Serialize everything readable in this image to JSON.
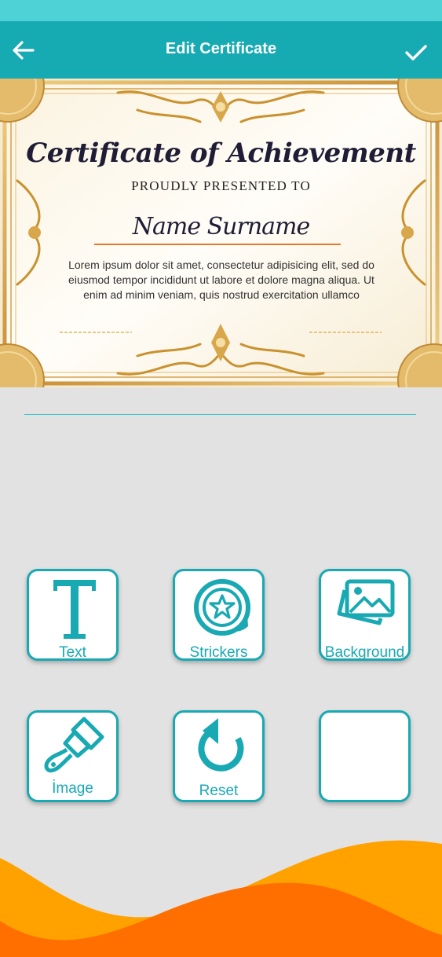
{
  "app_bar": {
    "title": "Edit Certificate",
    "back_icon": "arrow-left-icon",
    "confirm_icon": "checkmark-icon",
    "color": "#16aab3"
  },
  "status_bar": {
    "color": "#4fd2d5"
  },
  "certificate": {
    "title": "Certificate of Achievement",
    "subtitle": "PROUDLY PRESENTED TO",
    "name": "Name Surname",
    "body": "Lorem ipsum dolor sit amet, consectetur adipisicing elit, sed do eiusmod tempor incididunt ut labore et dolore magna aliqua. Ut enim ad minim veniam, quis nostrud exercitation ullamco",
    "border_color": "#d4a24a",
    "underline_color": "#e5792b"
  },
  "tools": [
    {
      "label": "Text",
      "icon": "text-t-icon"
    },
    {
      "label": "Strickers",
      "icon": "sticker-star-icon"
    },
    {
      "label": "Background",
      "icon": "images-icon"
    },
    {
      "label": "İmage",
      "icon": "paint-brush-icon"
    },
    {
      "label": "Reset",
      "icon": "reset-rotate-icon"
    },
    {
      "label": "",
      "icon": ""
    }
  ],
  "accent_color": "#18a9b3",
  "wave_colors": [
    "#ffa200",
    "#ff6f00"
  ]
}
